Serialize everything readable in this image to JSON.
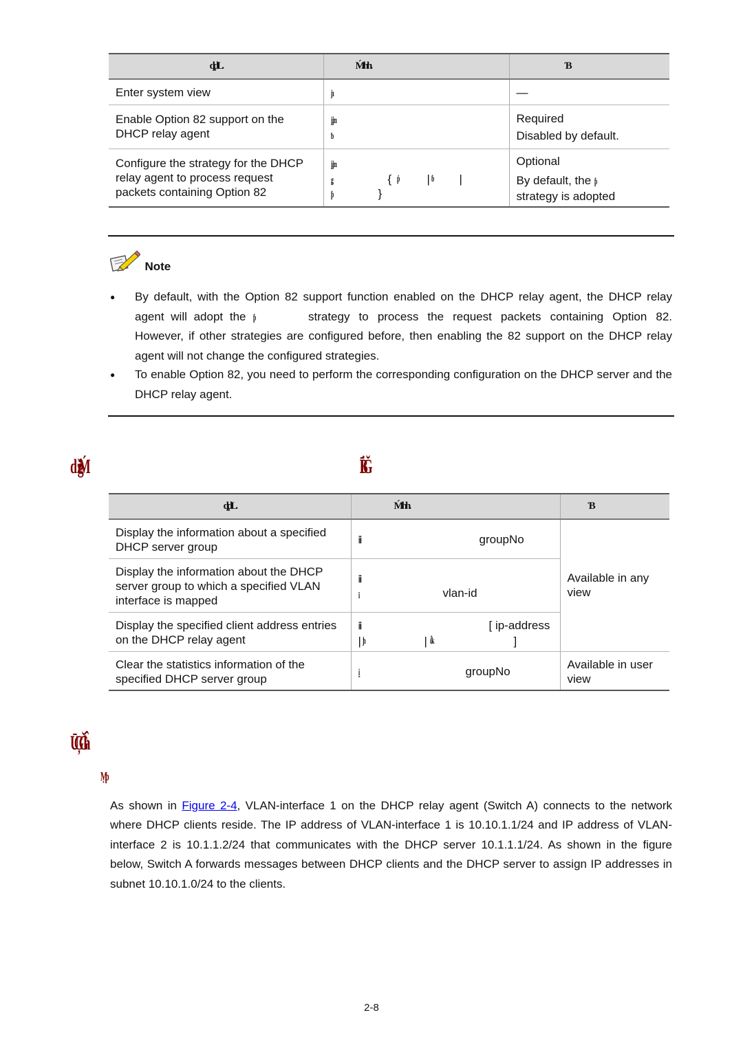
{
  "table1": {
    "headers": [
      "ȡdL.",
      "Ḿhh.",
      "Ɓ"
    ],
    "rows": [
      {
        "todo": "Enter system view",
        "command": [
          "јn"
        ],
        "remarks": [
          "—"
        ]
      },
      {
        "todo": "Enable Option 82 support on the DHCP relay agent",
        "command": [
          "ȷĳm",
          "ƅ"
        ],
        "remarks": [
          "Required",
          "Disabled by default."
        ]
      },
      {
        "todo": "Configure the strategy for the DHCP relay agent to process request packets containing Option 82",
        "command_lines": [
          [
            "ȷĳm"
          ],
          [
            "ǥ",
            "{",
            "ṗ",
            "|",
            "ɓ",
            "|"
          ],
          [
            "ƥ",
            "}"
          ]
        ],
        "remarks_line1": "Optional",
        "remarks_line2_prefix": "By default, the",
        "remarks_line2_kw": "ƥ",
        "remarks_line3": "strategy is adopted"
      }
    ]
  },
  "note": {
    "title": "Note",
    "bullets": [
      {
        "line1": "By default, with the Option 82 support function enabled on the DHCP relay agent, the DHCP relay",
        "line2_prefix": "agent will adopt the",
        "line2_kw": "ƥ",
        "line2_suffix": "strategy to process the request packets containing Option 82.",
        "rest": "However, if other strategies are configured before, then enabling the 82 support on the DHCP relay agent will not change the configured strategies."
      },
      {
        "text": "To enable Option 82, you need to perform the corresponding configuration on the DHCP server and the DHCP relay agent."
      }
    ]
  },
  "section_heading": {
    "left": "ǆĝḾ",
    "right": "ĪḂĞ"
  },
  "table2": {
    "headers": [
      "ȡdL.",
      "Ḿhh.",
      "Ɓ"
    ],
    "rows": [
      {
        "todo": "Display the information about a specified DHCP server group",
        "command_kw": "ⅲ",
        "command_arg": "groupNo"
      },
      {
        "todo": "Display the information about the DHCP server group to which a specified VLAN interface is mapped",
        "command_kw1": "ⅲ",
        "command_kw2": "ï",
        "command_arg": "vlan-id"
      },
      {
        "todo": "Display the specified client address entries on the DHCP relay agent",
        "command_kw": "ⅲ",
        "command_arg": "[ ip-address",
        "command_line2": [
          "|",
          "ȷh",
          "|",
          "ǚk",
          "]"
        ]
      },
      {
        "todo": "Clear the statistics information of the specified DHCP server group",
        "command_kw": "ḭ",
        "command_arg": "groupNo"
      }
    ],
    "remarks": [
      "Available in any view",
      "Available in user view"
    ]
  },
  "example_heading": "ŪĢĞĥ",
  "network_req_heading": "Ṃp",
  "paragraph": {
    "prefix": "As shown in ",
    "link": "Figure 2-4",
    "text": ", VLAN-interface 1 on the DHCP relay agent (Switch A) connects to the network where DHCP clients reside. The IP address of VLAN-interface 1 is 10.10.1.1/24 and IP address of VLAN-interface 2 is 10.1.1.2/24 that communicates with the DHCP server 10.1.1.1/24. As shown in the figure below, Switch A forwards messages between DHCP clients and the DHCP server to assign IP addresses in subnet 10.10.1.0/24 to the clients."
  },
  "page_number": "2-8"
}
